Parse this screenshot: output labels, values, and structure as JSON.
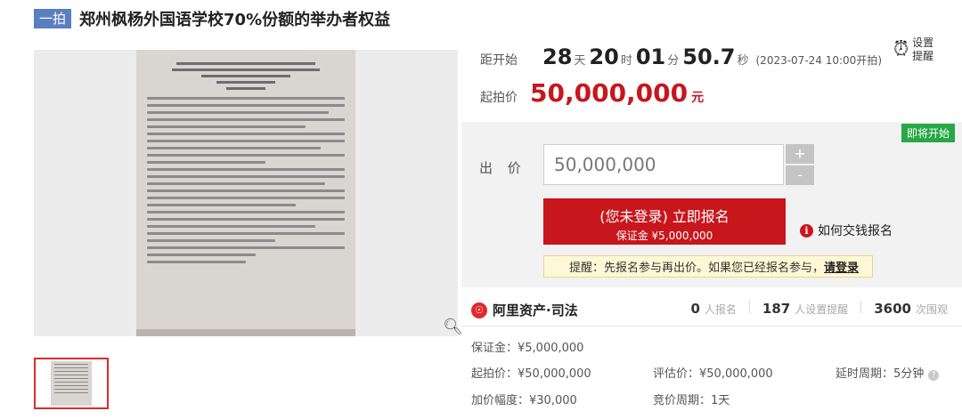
{
  "header": {
    "badge": "一拍",
    "title": "郑州枫杨外国语学校70%份额的举办者权益"
  },
  "countdown": {
    "label": "距开始",
    "days": "28",
    "days_unit": "天",
    "hours": "20",
    "hours_unit": "时",
    "minutes": "01",
    "minutes_unit": "分",
    "seconds": "50.7",
    "seconds_unit": "秒",
    "start_time": "(2023-07-24 10:00开拍)"
  },
  "reminder": {
    "line1": "设置",
    "line2": "提醒",
    "icon": "alarm-clock-icon"
  },
  "start_price": {
    "label": "起拍价",
    "value": "50,000,000",
    "unit": "元"
  },
  "bid": {
    "status_badge": "即将开始",
    "label": "出 价",
    "input_value": "50,000,000",
    "plus": "+",
    "minus": "-",
    "signup_main": "(您未登录) 立即报名",
    "signup_sub": "保证金 ¥5,000,000",
    "howto": "如何交钱报名",
    "notice_text": "提醒：先报名参与再出价。如果您已经报名参与，",
    "notice_link": "请登录"
  },
  "platform": {
    "name": "阿里资产·司法",
    "signup_count": "0",
    "signup_label": "人报名",
    "remind_count": "187",
    "remind_label": "人设置提醒",
    "view_count": "3600",
    "view_label": "次围观"
  },
  "details": {
    "deposit": "保证金：¥5,000,000",
    "start_price": "起拍价：¥50,000,000",
    "appraisal": "评估价：¥50,000,000",
    "extension": "延时周期：5分钟",
    "increment": "加价幅度：¥30,000",
    "cycle": "竞价周期：1天"
  }
}
